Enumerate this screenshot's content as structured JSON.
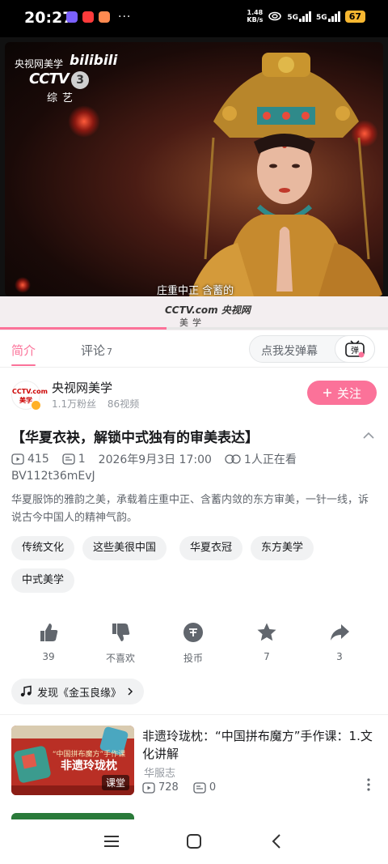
{
  "status_bar": {
    "time": "20:27",
    "dots": "···",
    "net_speed_value": "1.48",
    "net_speed_unit": "KB/s",
    "signal1": "5G",
    "signal2": "5G",
    "battery": "67"
  },
  "video": {
    "source_text": "央视网美学",
    "watermark": "bilibili",
    "channel_logo": "CCTV",
    "channel_num": "3",
    "channel_sub": "综艺",
    "subtitle": "庄重中正 含蓄的",
    "bottom_logo": "CCTV.com 央视网",
    "bottom_logo_sub": "美学",
    "progress": 0.43
  },
  "tabs": {
    "intro": "简介",
    "comments": "评论",
    "comments_count": "7",
    "danmu_placeholder": "点我发弹幕",
    "danmu_icon_label": "弹"
  },
  "uploader": {
    "avatar_text_1": "CCTV.com",
    "avatar_text_2": "美学",
    "name": "央视网美学",
    "fans": "1.1万粉丝",
    "videos": "86视频",
    "follow_label": "关注"
  },
  "video_info": {
    "title": "【华夏衣袂，解锁中式独有的审美表达】",
    "plays": "415",
    "danmaku": "1",
    "date": "2026年9月3日 17:00",
    "watching": "1人正在看",
    "bvid": "BV112t36mEvJ",
    "description": "华夏服饰的雅韵之美，承载着庄重中正、含蓄内敛的东方审美，一针一线，诉说古今中国人的精神气韵。"
  },
  "tags": [
    "传统文化",
    "这些美很中国",
    "华夏衣冠",
    "东方美学",
    "中式美学"
  ],
  "actions": {
    "like": "39",
    "dislike": "不喜欢",
    "coin": "投币",
    "favorite": "7",
    "share": "3"
  },
  "music": {
    "label": "发现《金玉良缘》"
  },
  "recommendations": [
    {
      "title": "非遗玲珑枕：“中国拼布魔方”手作课：1.文化讲解",
      "author": "华服志",
      "plays": "728",
      "danmaku": "0",
      "badge": "课堂",
      "thumb_title": "非遗玲珑枕",
      "thumb_sub": "“中国拼布魔方”手作课"
    }
  ],
  "colors": {
    "accent": "#fb7299",
    "text_primary": "#18191c",
    "text_secondary": "#61666d",
    "text_tertiary": "#9499a0"
  }
}
